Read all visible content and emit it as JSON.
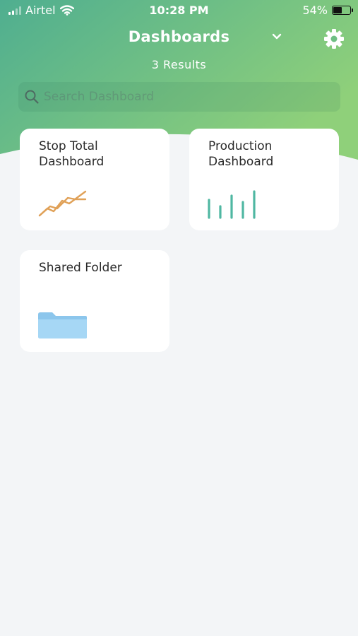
{
  "status_bar": {
    "carrier": "Airtel",
    "time": "10:28 PM",
    "battery": "54%",
    "battery_level": 0.54
  },
  "header": {
    "title": "Dashboards",
    "results": "3 Results"
  },
  "search": {
    "placeholder": "Search Dashboard",
    "value": ""
  },
  "cards": [
    {
      "label": "Stop Total Dashboard",
      "icon": "line-chart-icon"
    },
    {
      "label": "Production Dashboard",
      "icon": "bar-chart-icon"
    },
    {
      "label": "Shared Folder",
      "icon": "folder-icon"
    }
  ],
  "colors": {
    "gradient_start": "#4fae90",
    "gradient_end": "#8fd07a",
    "line_chart": "#e0a158",
    "bar_chart": "#4fb7a2",
    "folder": "#9ed0f2",
    "background": "#f3f5f7"
  }
}
